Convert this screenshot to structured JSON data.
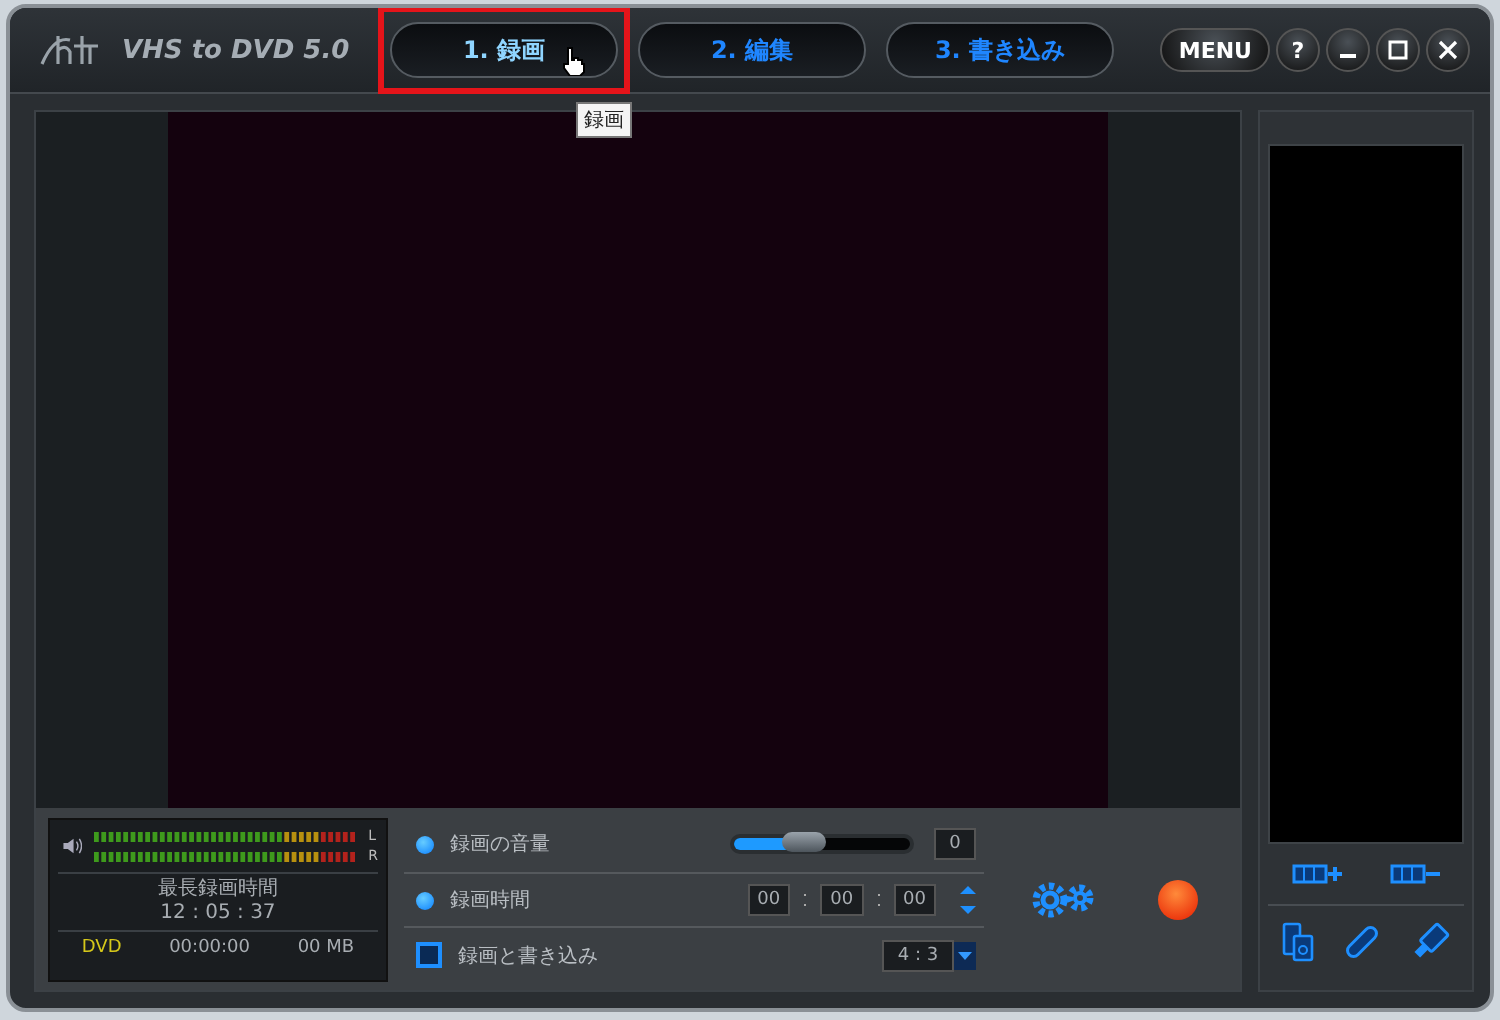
{
  "app": {
    "title": "VHS to DVD 5.0"
  },
  "tabs": [
    {
      "label": "1. 録画",
      "selected": true,
      "highlighted": true
    },
    {
      "label": "2. 編集",
      "selected": false,
      "highlighted": false
    },
    {
      "label": "3. 書き込み",
      "selected": false,
      "highlighted": false
    }
  ],
  "tooltip": "録画",
  "window_buttons": [
    "MENU",
    "?"
  ],
  "meter": {
    "channels": [
      "L",
      "R"
    ],
    "caption": "最長録画時間",
    "time": "12 : 05 : 37",
    "disc": "DVD",
    "duration": "00:00:00",
    "size": "00 MB"
  },
  "settings": [
    {
      "kind": "slider",
      "label": "録画の音量",
      "level": 0.4,
      "value": "0"
    },
    {
      "kind": "time",
      "label": "録画時間",
      "fields": [
        "00",
        "00",
        "00"
      ]
    },
    {
      "kind": "checkbox",
      "label": "録画と書き込み",
      "checked": false,
      "value": "4 : 3"
    }
  ]
}
